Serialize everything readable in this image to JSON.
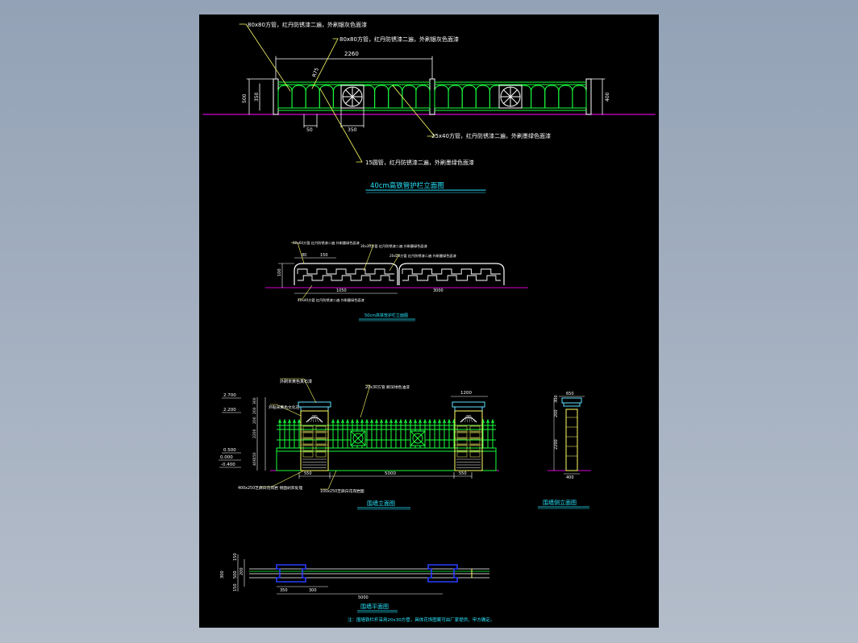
{
  "colors": {
    "background": "#000000",
    "window_gradient_top": "#93a2b6",
    "fence_green": "#19ff3c",
    "title_cyan": "#27e6ff",
    "dimension_white": "#ffffff",
    "ground_magenta": "#d400d4",
    "leader_yellow": "#ffff66",
    "pier_cap_cyan": "#5fe0ff",
    "plan_blue": "#2a3cff"
  },
  "drawing1": {
    "title": "40cm高铁管护栏立面图",
    "note_top1": "80x80方管，红丹防锈漆二遍，外刷银灰色面漆",
    "note_top2": "80x80方管，红丹防锈漆二遍，外刷银灰色面漆",
    "note_rail": "25x40方管，红丹防锈漆二遍，外刷墨绿色面漆",
    "note_round": "15圆管，红丹防锈漆二遍，外刷墨绿色面漆",
    "dim_span": "2260",
    "dim_height_outer": "500",
    "dim_height_inner": "350",
    "dim_arc": "R75",
    "dim_post": "50",
    "dim_circle": "350",
    "dim_right": "400"
  },
  "drawing2": {
    "title": "50cm高铁管护栏立面图",
    "note_a": "60x60方管 红丹防锈漆二遍 外刷墨绿色面漆",
    "note_b": "30x30方管 红丹防锈漆二遍 外刷墨绿色面漆",
    "note_c": "40x40方管 红丹防锈漆二遍 外刷墨绿色面漆",
    "note_d": "20x20方管 红丹防锈漆二遍 外刷墨绿色面漆",
    "dim_a": "80",
    "dim_b": "150",
    "dim_c": "100",
    "dim_d": "3000",
    "dim_e": "1050"
  },
  "drawing3": {
    "title": "围墙立面图",
    "note_cap": "外刷米黄色真石漆",
    "note_bars": "20x30方管 刷深绿色油漆",
    "note_stone": "外贴米黄色文化石",
    "note_base_left": "400x250芝麻白花岗岩 侧面剁斧处理",
    "note_base_bottom": "100x250芝麻白花岗岩面",
    "elev_2700": "2.700",
    "elev_2200": "2.200",
    "elev_0500": "0.500",
    "elev_0000": "0.000",
    "elev_m0400": "-0.400",
    "dim_span": "5000",
    "dim_pier_left": "550",
    "dim_pier_right": "550",
    "dim_cap": "1200",
    "v_dims": [
      "300",
      "200",
      "200",
      "2200",
      "150",
      "400"
    ]
  },
  "drawing4": {
    "title": "围墙侧立面图",
    "dim_top": "650",
    "dim_bottom": "400",
    "v_dims": [
      "300",
      "200",
      "2200"
    ]
  },
  "drawing5": {
    "title": "围墙平面图",
    "note": "注：围墙铁栏杆采用20x30方管，具体花饰图案可由厂家提供，甲方确定。",
    "dim_span": "5000",
    "dim_pier": "300",
    "dim_gap": "300",
    "dim_end": "350",
    "v_dims": [
      "150",
      "500",
      "200",
      "150"
    ]
  }
}
